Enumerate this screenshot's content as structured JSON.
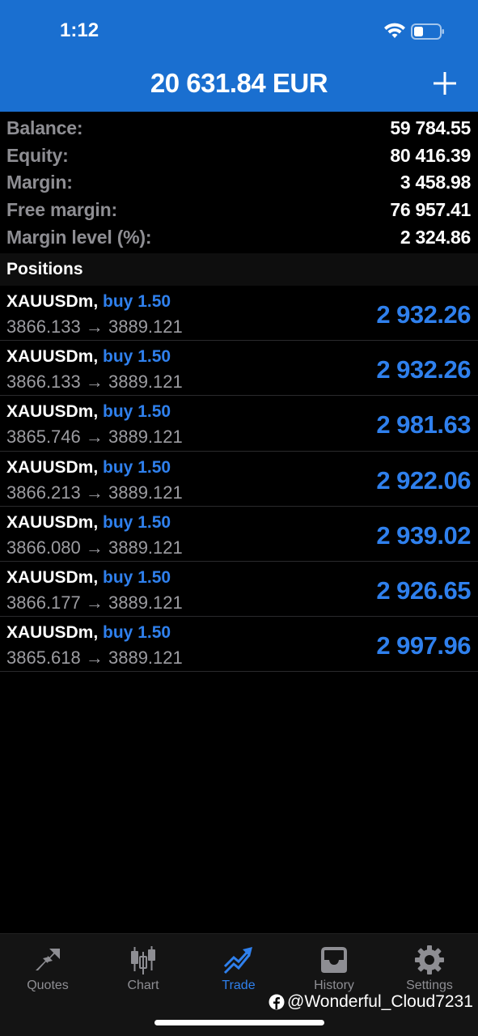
{
  "status_bar": {
    "time": "1:12"
  },
  "header": {
    "title": "20 631.84 EUR"
  },
  "summary": [
    {
      "label": "Balance:",
      "value": "59 784.55"
    },
    {
      "label": "Equity:",
      "value": "80 416.39"
    },
    {
      "label": "Margin:",
      "value": "3 458.98"
    },
    {
      "label": "Free margin:",
      "value": "76 957.41"
    },
    {
      "label": "Margin level (%):",
      "value": "2 324.86"
    }
  ],
  "positions": {
    "title": "Positions",
    "items": [
      {
        "symbol": "XAUUSDm,",
        "side": "buy 1.50",
        "prices": "3866.133 → 3889.121",
        "profit": "2 932.26"
      },
      {
        "symbol": "XAUUSDm,",
        "side": "buy 1.50",
        "prices": "3866.133 → 3889.121",
        "profit": "2 932.26"
      },
      {
        "symbol": "XAUUSDm,",
        "side": "buy 1.50",
        "prices": "3865.746 → 3889.121",
        "profit": "2 981.63"
      },
      {
        "symbol": "XAUUSDm,",
        "side": "buy 1.50",
        "prices": "3866.213 → 3889.121",
        "profit": "2 922.06"
      },
      {
        "symbol": "XAUUSDm,",
        "side": "buy 1.50",
        "prices": "3866.080 → 3889.121",
        "profit": "2 939.02"
      },
      {
        "symbol": "XAUUSDm,",
        "side": "buy 1.50",
        "prices": "3866.177 → 3889.121",
        "profit": "2 926.65"
      },
      {
        "symbol": "XAUUSDm,",
        "side": "buy 1.50",
        "prices": "3865.618 → 3889.121",
        "profit": "2 997.96"
      }
    ]
  },
  "tabbar": {
    "tabs": [
      {
        "label": "Quotes",
        "icon": "quotes-arrows-icon",
        "active": false
      },
      {
        "label": "Chart",
        "icon": "candlestick-icon",
        "active": false
      },
      {
        "label": "Trade",
        "icon": "trend-up-icon",
        "active": true
      },
      {
        "label": "History",
        "icon": "inbox-tray-icon",
        "active": false
      },
      {
        "label": "Settings",
        "icon": "gear-icon",
        "active": false
      }
    ]
  },
  "watermark": {
    "text": "@Wonderful_Cloud7231",
    "icon": "facebook-icon"
  },
  "colors": {
    "header_bg": "#1a6fd0",
    "accent": "#2f80ed",
    "label_gray": "#8e8e93"
  }
}
